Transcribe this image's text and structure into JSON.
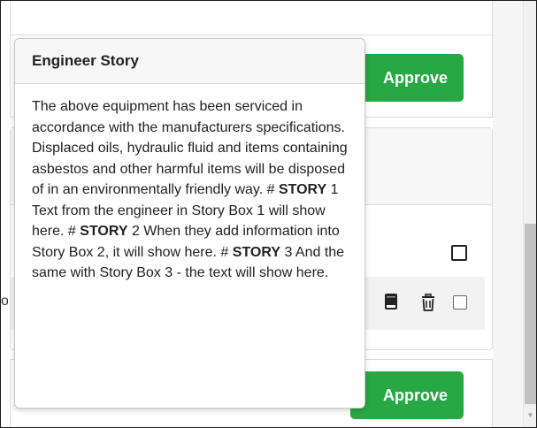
{
  "buttons": {
    "approve_top": "Approve",
    "approve_bottom": "Approve"
  },
  "row": {
    "cut_text": "o"
  },
  "icons": {
    "book": "book-icon",
    "trash": "trash-icon",
    "checkbox": "checkbox-icon"
  },
  "colors": {
    "approve": "#28a745"
  },
  "popover": {
    "title": "Engineer Story",
    "body": [
      "The above equipment has been serviced in accordance with the manufacturers specifications. Displaced oils, hydraulic fluid and items containing asbestos and other harmful items will be disposed of in an environmentally friendly way. # ",
      "STORY",
      " 1 Text from the engineer in Story Box 1 will show here. # ",
      "STORY",
      " 2 When they add information into Story Box 2, it will show here. # ",
      "STORY",
      " 3 And the same with Story Box 3 - the text will show here."
    ]
  }
}
